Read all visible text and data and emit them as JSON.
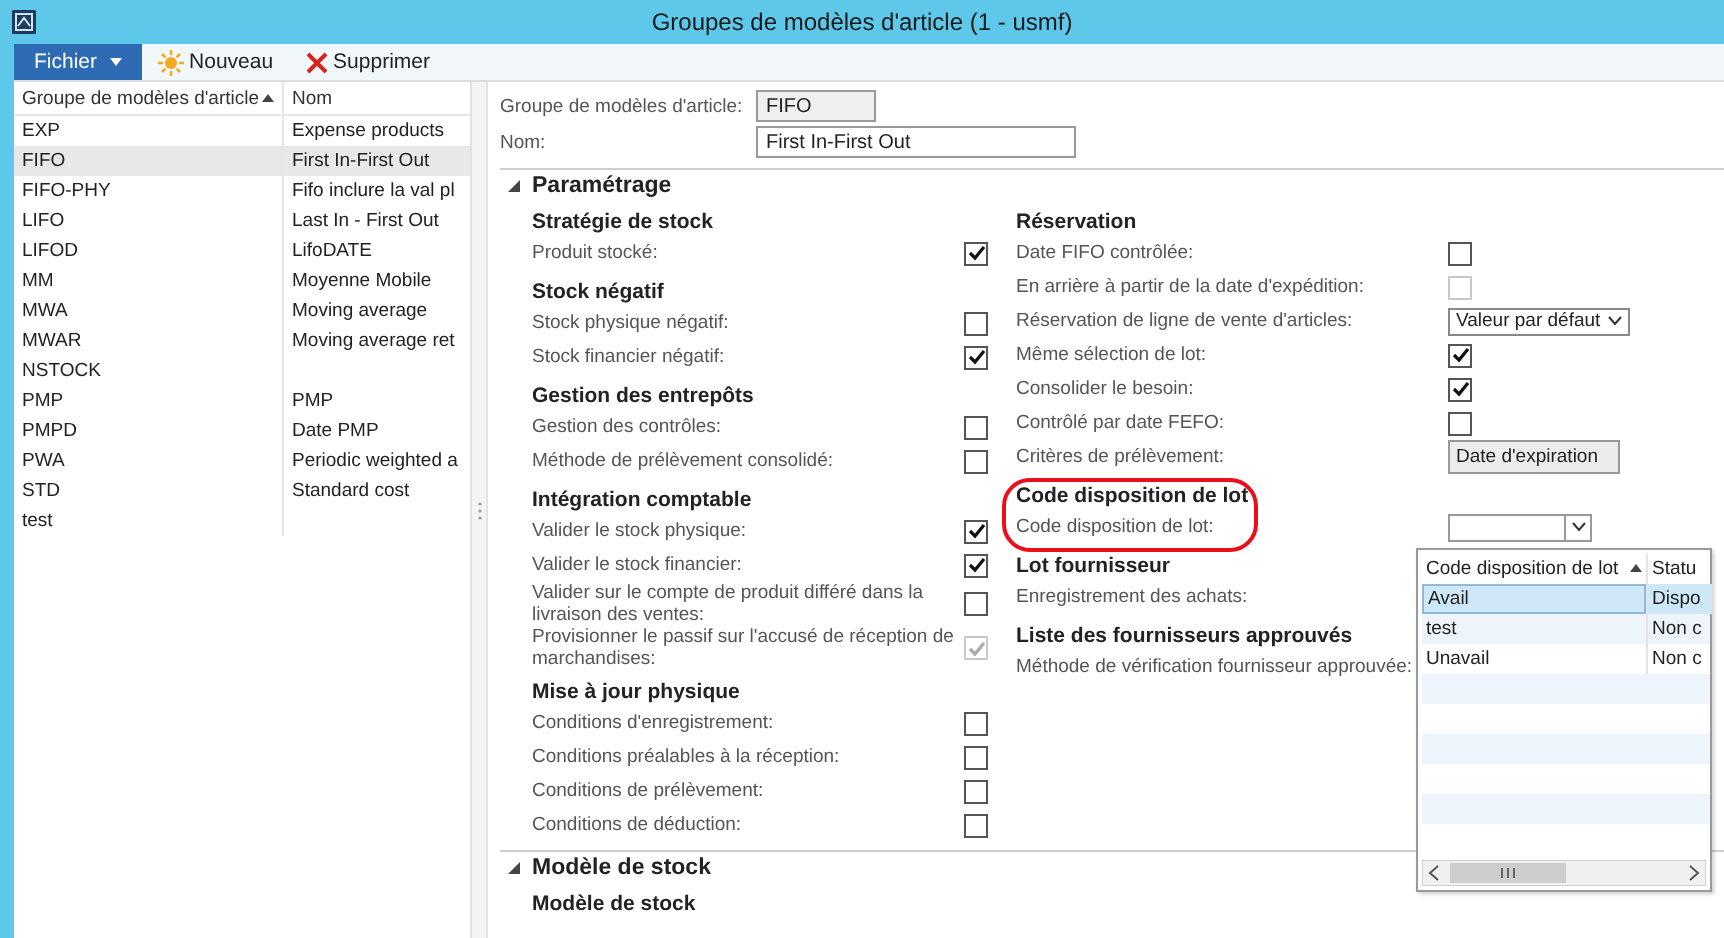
{
  "window": {
    "title": "Groupes de modèles d'article (1 - usmf)"
  },
  "toolbar": {
    "file_menu": "Fichier",
    "buttons": [
      {
        "label": "Nouveau",
        "kind": "new"
      },
      {
        "label": "Supprimer",
        "kind": "delete"
      }
    ]
  },
  "list": {
    "columns": [
      {
        "label": "Groupe de modèles d'article",
        "sorted": true
      },
      {
        "label": "Nom",
        "sorted": false
      }
    ],
    "rows": [
      {
        "cells": [
          "EXP",
          "Expense products"
        ],
        "selected": false
      },
      {
        "cells": [
          "FIFO",
          "First In-First Out"
        ],
        "selected": true
      },
      {
        "cells": [
          "FIFO-PHY",
          "Fifo inclure la val pl"
        ],
        "selected": false
      },
      {
        "cells": [
          "LIFO",
          "Last In - First Out"
        ],
        "selected": false
      },
      {
        "cells": [
          "LIFOD",
          "LifoDATE"
        ],
        "selected": false
      },
      {
        "cells": [
          "MM",
          "Moyenne Mobile"
        ],
        "selected": false
      },
      {
        "cells": [
          "MWA",
          "Moving average"
        ],
        "selected": false
      },
      {
        "cells": [
          "MWAR",
          "Moving average ret"
        ],
        "selected": false
      },
      {
        "cells": [
          "NSTOCK"
        ],
        "selected": false
      },
      {
        "cells": [
          "PMP",
          "PMP"
        ],
        "selected": false
      },
      {
        "cells": [
          "PMPD",
          "Date PMP"
        ],
        "selected": false
      },
      {
        "cells": [
          "PWA",
          "Periodic weighted a"
        ],
        "selected": false
      },
      {
        "cells": [
          "STD",
          "Standard cost"
        ],
        "selected": false
      },
      {
        "cells": [
          "test"
        ],
        "selected": false
      }
    ]
  },
  "header_fields": [
    {
      "label": "Groupe de modèles d'article:",
      "value": "FIFO",
      "readonly": true
    },
    {
      "label": "Nom:",
      "value": "First In-First Out",
      "readonly": false
    }
  ],
  "fasttabs": [
    {
      "title": "Paramétrage",
      "expanded": true,
      "columns": [
        [
          {
            "title": "Stratégie de stock",
            "highlighted": false,
            "rows": [
              {
                "kind": "checkbox",
                "label": "Produit stocké:",
                "checked": true,
                "disabled": false
              }
            ]
          },
          {
            "title": "Stock négatif",
            "highlighted": false,
            "rows": [
              {
                "kind": "checkbox",
                "label": "Stock physique négatif:",
                "checked": false,
                "disabled": false
              },
              {
                "kind": "checkbox",
                "label": "Stock financier négatif:",
                "checked": true,
                "disabled": false
              }
            ]
          },
          {
            "title": "Gestion des entrepôts",
            "highlighted": false,
            "rows": [
              {
                "kind": "checkbox",
                "label": "Gestion des contrôles:",
                "checked": false,
                "disabled": false
              },
              {
                "kind": "checkbox",
                "label": "Méthode de prélèvement consolidé:",
                "checked": false,
                "disabled": false
              }
            ]
          },
          {
            "title": "Intégration comptable",
            "highlighted": false,
            "rows": [
              {
                "kind": "checkbox",
                "label": "Valider le stock physique:",
                "checked": true,
                "disabled": false
              },
              {
                "kind": "checkbox",
                "label": "Valider le stock financier:",
                "checked": true,
                "disabled": false
              },
              {
                "kind": "checkbox",
                "label": "Valider sur le compte de produit différé dans la livraison des ventes:",
                "checked": false,
                "disabled": false
              },
              {
                "kind": "checkbox",
                "label": "Provisionner le passif sur l'accusé de réception de marchandises:",
                "checked": true,
                "disabled": true
              }
            ]
          },
          {
            "title": "Mise à jour physique",
            "highlighted": false,
            "rows": [
              {
                "kind": "checkbox",
                "label": "Conditions d'enregistrement:",
                "checked": false,
                "disabled": false
              },
              {
                "kind": "checkbox",
                "label": "Conditions préalables à la réception:",
                "checked": false,
                "disabled": false
              },
              {
                "kind": "checkbox",
                "label": "Conditions de prélèvement:",
                "checked": false,
                "disabled": false
              },
              {
                "kind": "checkbox",
                "label": "Conditions de déduction:",
                "checked": false,
                "disabled": false
              }
            ]
          }
        ],
        [
          {
            "title": "Réservation",
            "highlighted": false,
            "rows": [
              {
                "kind": "checkbox",
                "label": "Date FIFO contrôlée:",
                "checked": false,
                "disabled": false
              },
              {
                "kind": "checkbox",
                "label": "En arrière à partir de la date d'expédition:",
                "checked": false,
                "disabled": true
              },
              {
                "kind": "dropdown",
                "label": "Réservation de ligne de vente d'articles:",
                "value": "Valeur par défaut"
              },
              {
                "kind": "checkbox",
                "label": "Même sélection de lot:",
                "checked": true,
                "disabled": false
              },
              {
                "kind": "checkbox",
                "label": "Consolider le besoin:",
                "checked": true,
                "disabled": false
              },
              {
                "kind": "checkbox",
                "label": "Contrôlé par date FEFO:",
                "checked": false,
                "disabled": false
              },
              {
                "kind": "field",
                "label": "Critères de prélèvement:",
                "value": "Date d'expiration"
              }
            ]
          },
          {
            "title": "Code disposition de lot",
            "highlighted": true,
            "rows": [
              {
                "kind": "combo",
                "label": "Code disposition de lot:"
              }
            ]
          },
          {
            "title": "Lot fournisseur",
            "highlighted": false,
            "rows": [
              {
                "kind": "label",
                "label": "Enregistrement des achats:"
              }
            ]
          },
          {
            "title": "Liste des fournisseurs approuvés",
            "highlighted": false,
            "rows": [
              {
                "kind": "label",
                "label": "Méthode de vérification fournisseur approuvée:"
              }
            ]
          }
        ]
      ]
    },
    {
      "title": "Modèle de stock",
      "expanded": true,
      "columns": [
        [
          {
            "title": "Modèle de stock",
            "highlighted": false
          }
        ]
      ]
    }
  ],
  "lookup_popup": {
    "columns": [
      {
        "label": "Code disposition de lot",
        "sorted": true
      },
      {
        "label": "Statu",
        "sorted": false
      }
    ],
    "rows": [
      {
        "cells": [
          "Avail",
          "Dispo"
        ],
        "selected": true
      },
      {
        "cells": [
          "test",
          "Non c"
        ],
        "selected": false
      },
      {
        "cells": [
          "Unavail",
          "Non c"
        ],
        "selected": false
      }
    ]
  }
}
